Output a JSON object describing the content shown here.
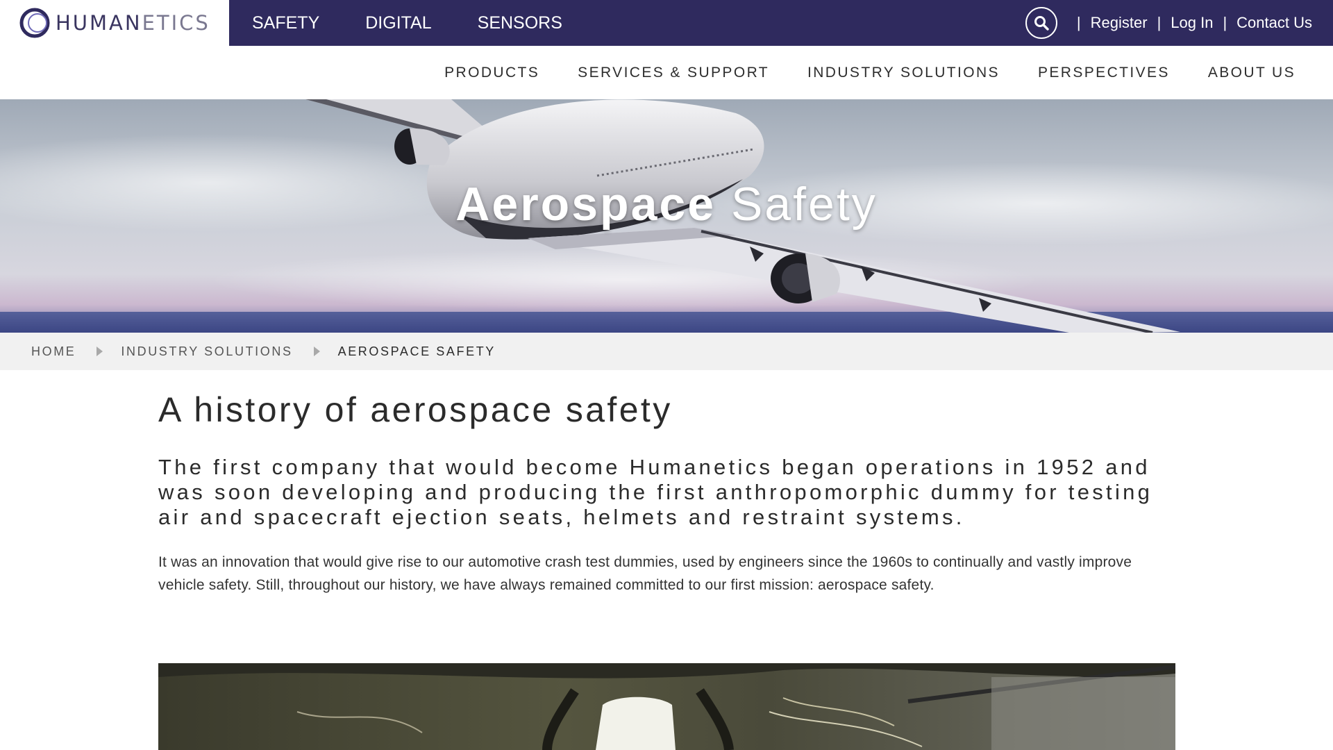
{
  "brand": {
    "logo_text_bold": "HUMAN",
    "logo_text_light": "ETICS",
    "accent_color": "#2f2a5e"
  },
  "brand_tabs": [
    {
      "label": "SAFETY"
    },
    {
      "label": "DIGITAL"
    },
    {
      "label": "SENSORS"
    }
  ],
  "utility": {
    "search_icon": "search-icon",
    "separator": "|",
    "register": "Register",
    "login": "Log In",
    "contact": "Contact Us"
  },
  "main_nav": [
    {
      "label": "PRODUCTS"
    },
    {
      "label": "SERVICES & SUPPORT"
    },
    {
      "label": "INDUSTRY SOLUTIONS"
    },
    {
      "label": "PERSPECTIVES"
    },
    {
      "label": "ABOUT US"
    }
  ],
  "hero": {
    "title_strong": "Aerospace",
    "title_light": "Safety",
    "image": "airplane-in-flight-over-ocean"
  },
  "breadcrumb": {
    "items": [
      "HOME",
      "INDUSTRY SOLUTIONS",
      "AEROSPACE SAFETY"
    ],
    "arrow_icon": "triangle-right-icon"
  },
  "content": {
    "heading": "A history of aerospace safety",
    "lead": "The first company that would become Humanetics began operations in 1952 and was soon developing and producing the first anthropomorphic dummy for testing air and spacecraft ejection seats, helmets and restraint systems.",
    "body": "It was an innovation that would give rise to our automotive crash test dummies, used by engineers since the 1960s to continually and vastly improve vehicle safety. Still, throughout our history, we have always remained committed to our first mission: aerospace safety.",
    "media": "aircraft-interior-wreckage-photo"
  }
}
